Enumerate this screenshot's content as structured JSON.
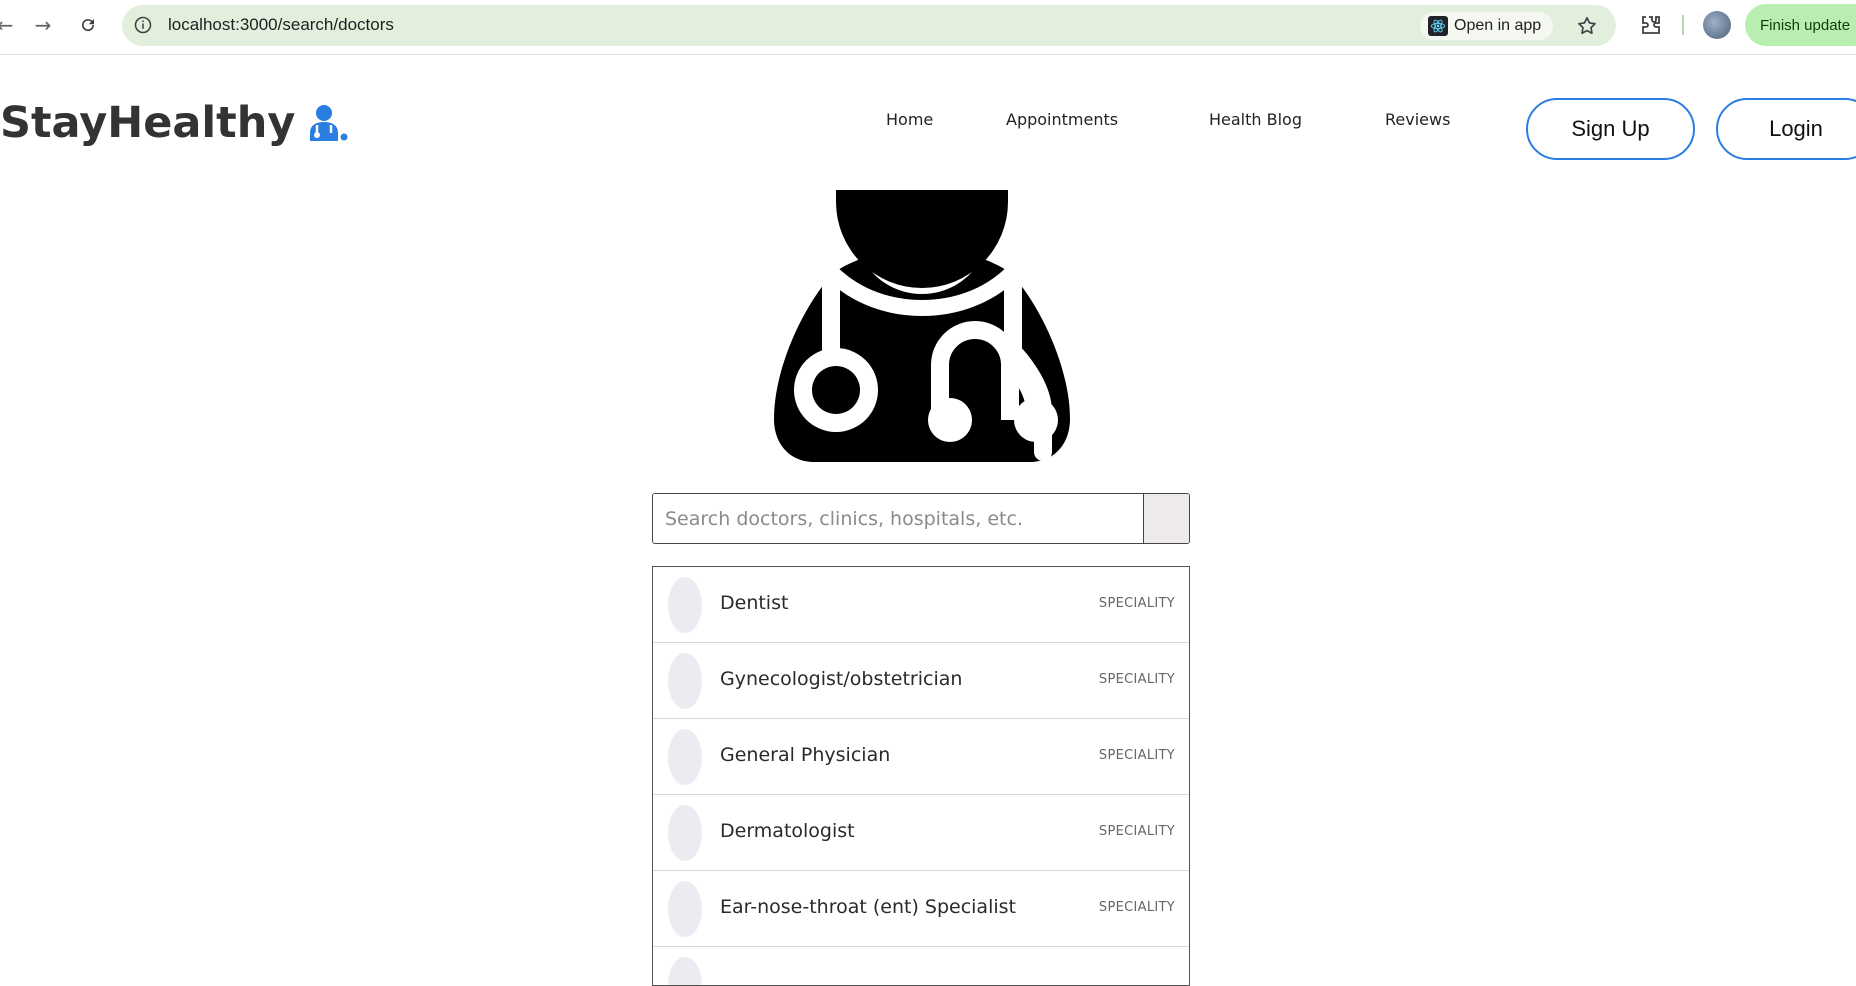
{
  "browser": {
    "url": "localhost:3000/search/doctors",
    "open_in_app_label": "Open in app",
    "finish_update_label": "Finish update"
  },
  "site": {
    "logo_text": "StayHealthy",
    "nav": [
      "Home",
      "Appointments",
      "Health Blog",
      "Reviews"
    ],
    "signup_label": "Sign Up",
    "login_label": "Login"
  },
  "search": {
    "placeholder": "Search doctors, clinics, hospitals, etc.",
    "value": ""
  },
  "results": [
    {
      "name": "Dentist",
      "tag": "SPECIALITY"
    },
    {
      "name": "Gynecologist/obstetrician",
      "tag": "SPECIALITY"
    },
    {
      "name": "General Physician",
      "tag": "SPECIALITY"
    },
    {
      "name": "Dermatologist",
      "tag": "SPECIALITY"
    },
    {
      "name": "Ear-nose-throat (ent) Specialist",
      "tag": "SPECIALITY"
    }
  ],
  "colors": {
    "accent": "#2a7de1",
    "omnibox": "#e3efdd",
    "finish_update": "#b8efb0"
  }
}
